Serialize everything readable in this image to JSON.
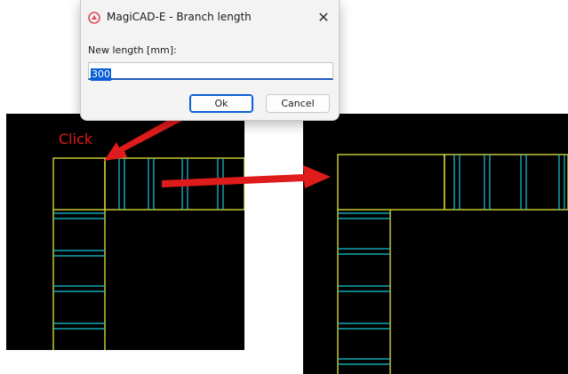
{
  "dialog": {
    "title": "MagiCAD-E - Branch length",
    "close_glyph": "✕",
    "field_label": "New length [mm]:",
    "length_value": "300",
    "ok_label": "Ok",
    "cancel_label": "Cancel",
    "app_icon": "magicad-logo-icon"
  },
  "annotation": {
    "click_label": "Click",
    "color": "#e01b1b"
  },
  "colors": {
    "cad_background": "#000000",
    "cad_outline": "#c8c832",
    "cad_rungs": "#18c8d8",
    "accent": "#0a5fd6"
  }
}
